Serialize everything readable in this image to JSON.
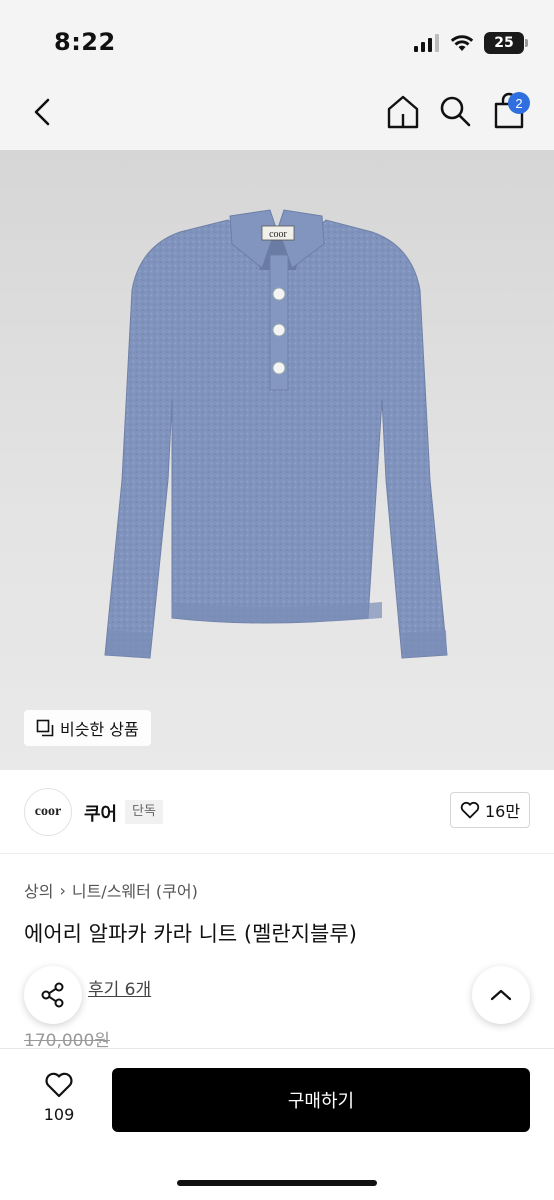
{
  "status_bar": {
    "time": "8:22",
    "battery": "25"
  },
  "header": {
    "cart_count": "2"
  },
  "hero": {
    "similar_label": "비슷한 상품",
    "garment_label": "coor"
  },
  "brand": {
    "logo_text": "coor",
    "name": "쿠어",
    "tag": "단독",
    "likes": "16만"
  },
  "breadcrumb": {
    "category": "상의",
    "separator": "›",
    "subcategory": "니트/스웨터 (쿠어)"
  },
  "product": {
    "name": "에어리 알파카 카라 니트 (멜란지블루)",
    "reviews_label": "후기 6개",
    "original_price": "170,000원"
  },
  "bottom": {
    "wish_count": "109",
    "buy_label": "구매하기"
  },
  "colors": {
    "accent": "#2f6fe0",
    "sweater": "#7f93bd",
    "buy_button": "#000000"
  }
}
